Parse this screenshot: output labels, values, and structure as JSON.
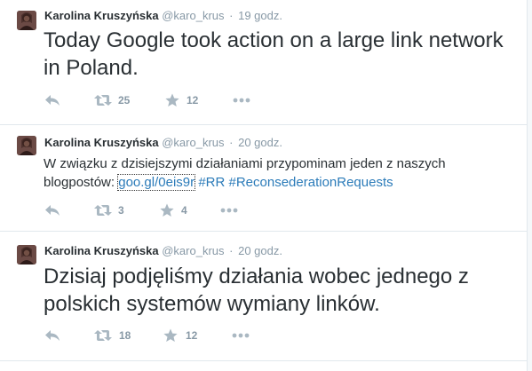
{
  "tweets": [
    {
      "name": "Karolina Kruszyńska",
      "handle": "@karo_krus",
      "time": "19 godz.",
      "text": "Today Google took action on a large link network in Poland.",
      "retweets": "25",
      "favorites": "12"
    },
    {
      "name": "Karolina Kruszyńska",
      "handle": "@karo_krus",
      "time": "20 godz.",
      "text_before": "W związku z dzisiejszymi działaniami przypominam jeden z naszych blogpostów: ",
      "link": "goo.gl/0eis9r",
      "hashtag1": "#RR",
      "hashtag2": "#ReconsederationRequests",
      "retweets": "3",
      "favorites": "4"
    },
    {
      "name": "Karolina Kruszyńska",
      "handle": "@karo_krus",
      "time": "20 godz.",
      "text": "Dzisiaj podjęliśmy działania wobec jednego z polskich systemów wymiany linków.",
      "retweets": "18",
      "favorites": "12"
    }
  ],
  "icons": {
    "reply": "reply-icon",
    "retweet": "retweet-icon",
    "favorite": "star-icon",
    "more": "more-icon"
  },
  "colors": {
    "link": "#2b7bb9",
    "muted": "#8899a6",
    "icon": "#aab8c2",
    "text": "#292f33"
  }
}
